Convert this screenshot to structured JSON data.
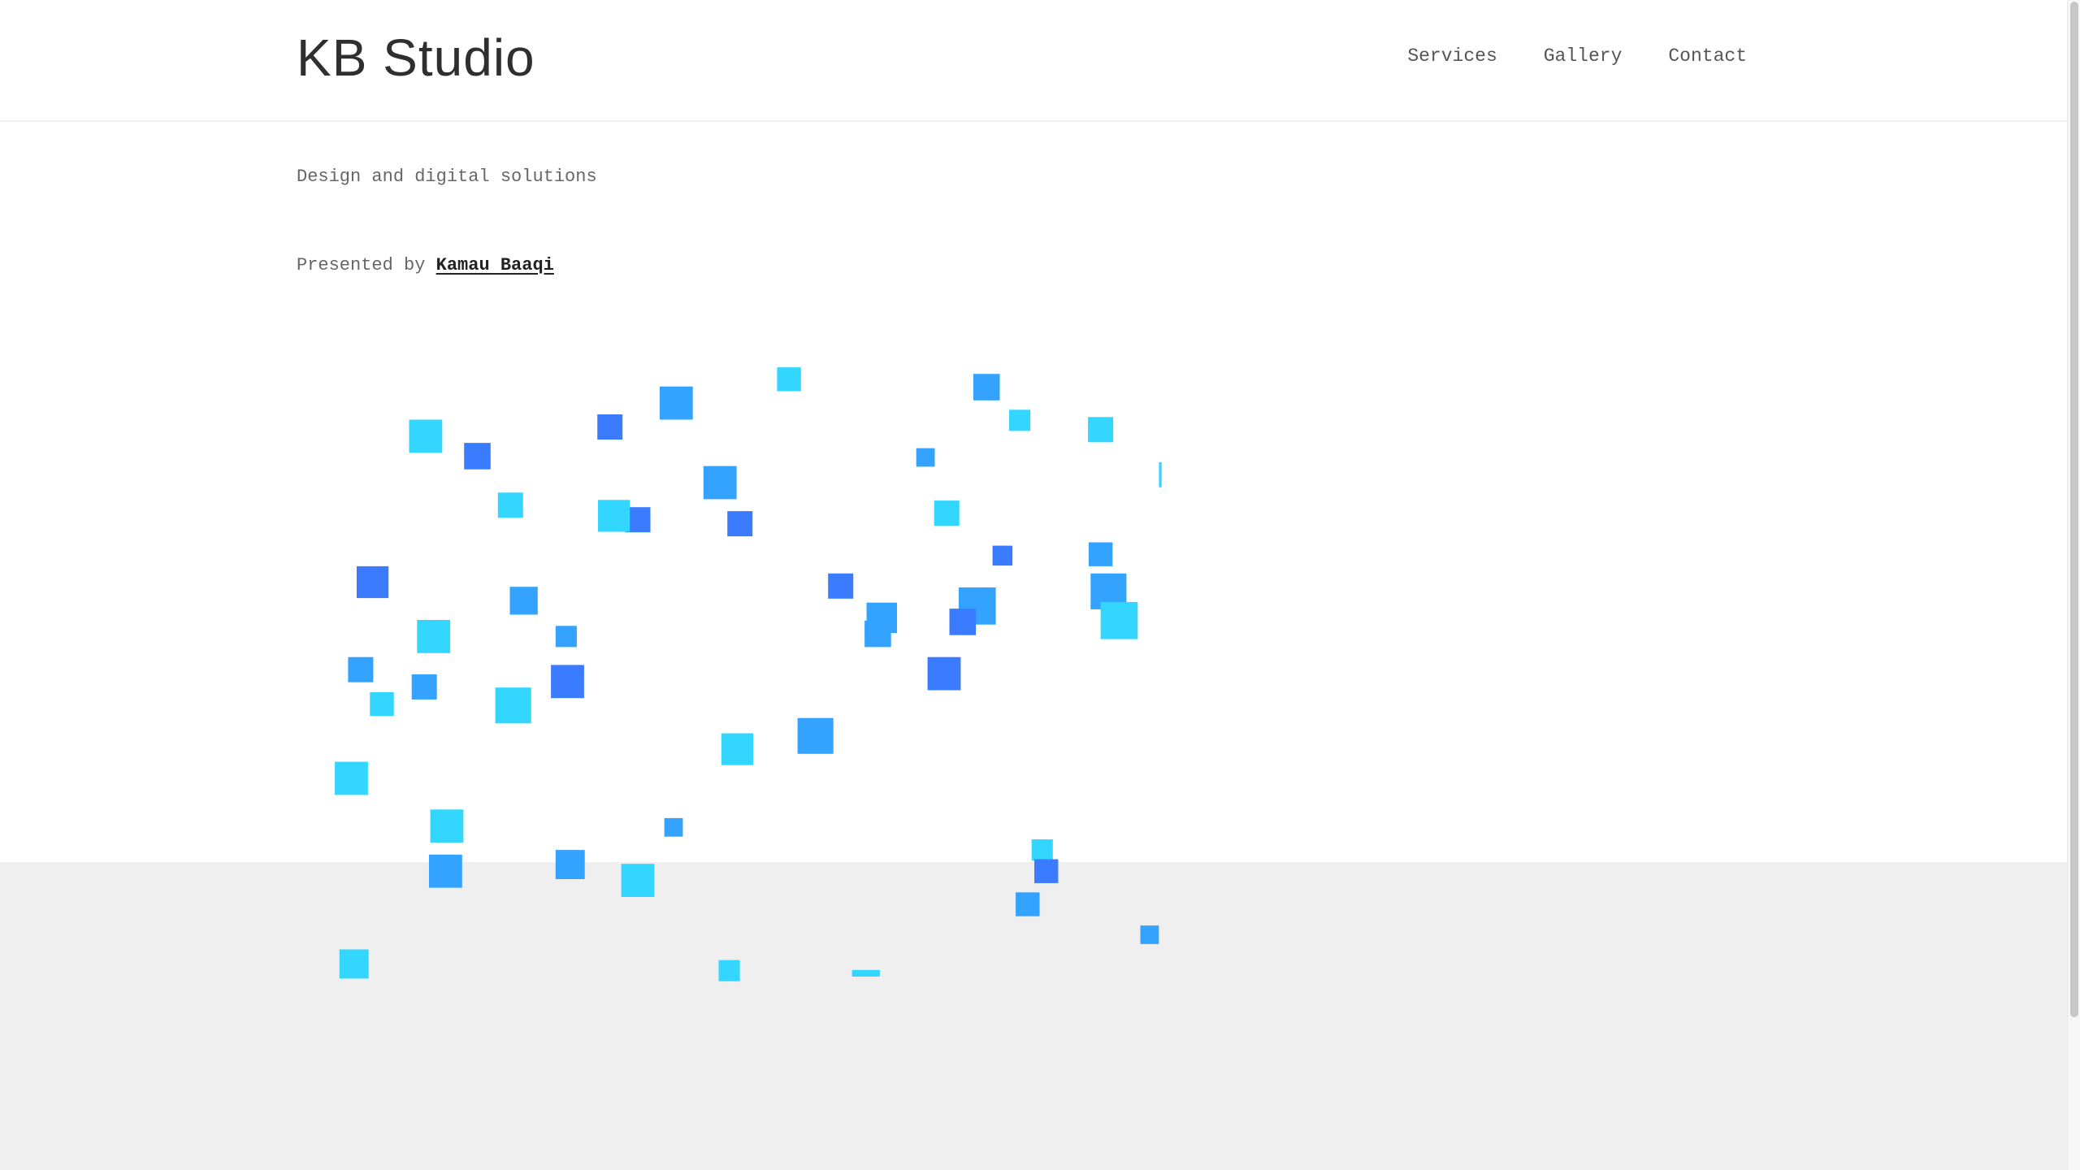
{
  "header": {
    "logo": "KB Studio",
    "nav": [
      {
        "label": "Services"
      },
      {
        "label": "Gallery"
      },
      {
        "label": "Contact"
      }
    ]
  },
  "hero": {
    "tagline": "Design and digital solutions",
    "presented_prefix": "Presented by ",
    "presenter": "Kamau Baaqi"
  },
  "colors": {
    "blue": "#3a7bff",
    "mid": "#33a3ff",
    "cyan": "#33d6ff",
    "footer": "#efefef"
  }
}
